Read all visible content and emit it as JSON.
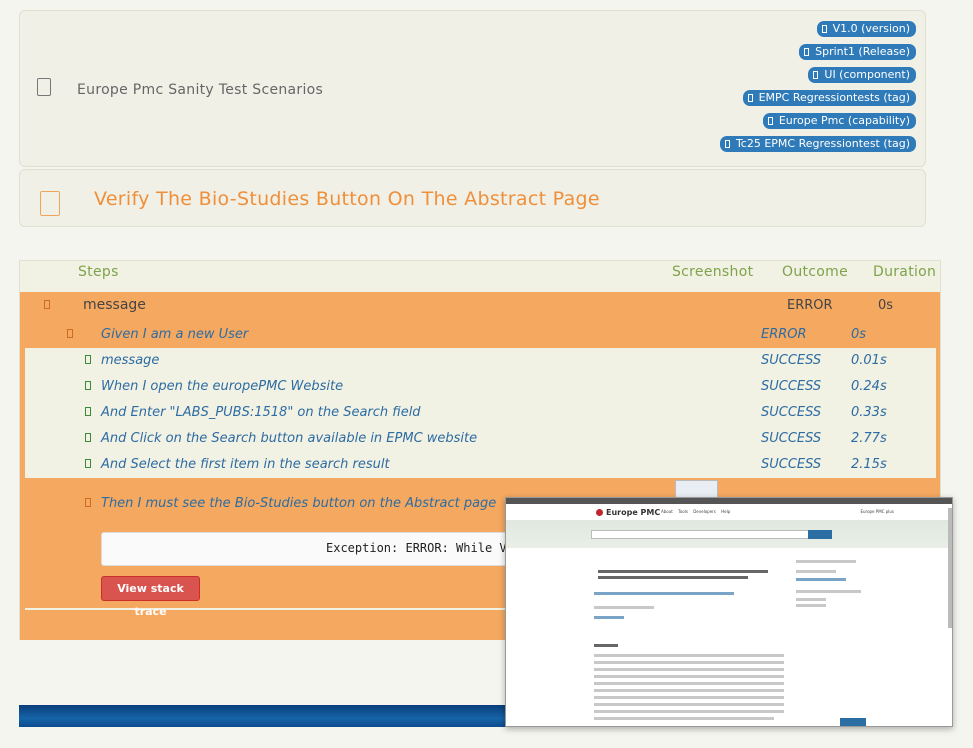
{
  "feature": {
    "title": "Europe Pmc Sanity Test Scenarios",
    "tags": [
      "V1.0 (version)",
      "Sprint1 (Release)",
      "UI (component)",
      "EMPC Regressiontests (tag)",
      "Europe Pmc (capability)",
      "Tc25 EPMC Regressiontest (tag)"
    ]
  },
  "scenario": {
    "title": "Verify The Bio-Studies Button On The Abstract Page"
  },
  "table": {
    "headers": {
      "steps": "Steps",
      "screenshot": "Screenshot",
      "outcome": "Outcome",
      "duration": "Duration"
    },
    "top_row": {
      "label": "message",
      "outcome": "ERROR",
      "duration": "0s"
    },
    "given": {
      "text": "Given I am a new User",
      "outcome": "ERROR",
      "duration": "0s"
    },
    "steps": [
      {
        "text": "message",
        "outcome": "SUCCESS",
        "duration": "0.01s"
      },
      {
        "text": "When I open the europePMC Website",
        "outcome": "SUCCESS",
        "duration": "0.24s"
      },
      {
        "text": "And Enter \"LABS_PUBS:1518\" on the Search field",
        "outcome": "SUCCESS",
        "duration": "0.33s"
      },
      {
        "text": "And Click on the Search button available in EPMC website",
        "outcome": "SUCCESS",
        "duration": "2.77s"
      },
      {
        "text": "And Select the first item in the search result",
        "outcome": "SUCCESS",
        "duration": "2.15s"
      }
    ],
    "failed_step": {
      "text": "Then I must see the Bio-Studies button on the Abstract page"
    },
    "exception": "Exception: ERROR: While Veri",
    "stack_button": "View stack trace"
  },
  "popup": {
    "logo": "Europe PMC",
    "nav": "About Tools Developers Help",
    "right": "Europe PMC plus"
  }
}
